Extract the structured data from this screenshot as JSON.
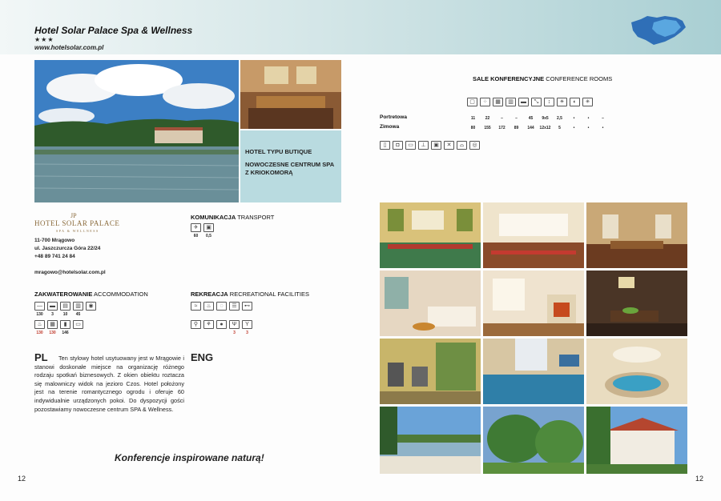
{
  "header": {
    "hotel_name": "Hotel Solar Palace Spa & Wellness",
    "stars": "★★★",
    "website": "www.hotelsolar.com.pl"
  },
  "info_box": {
    "line1": "HOTEL TYPU BUTIQUE",
    "line2": "NOWOCZESNE CENTRUM SPA Z KRIOKOMORĄ"
  },
  "logo": {
    "monogram": "JP",
    "text": "HOTEL SOLAR PALACE",
    "tagline": "SPA & WELLNESS"
  },
  "address": {
    "line1": "11-700 Mrągowo",
    "line2": "ul. Jaszczurcza Góra 22/24",
    "phone": "+48 89 741 24 84",
    "email": "mragowo@hotelsolar.com.pl"
  },
  "transport": {
    "title_pl": "KOMUNIKACJA",
    "title_en": "TRANSPORT",
    "values": [
      "60",
      "0,5"
    ]
  },
  "accommodation": {
    "title_pl": "ZAKWATEROWANIE",
    "title_en": "ACCOMMODATION",
    "row1_values": [
      "130",
      "3",
      "10",
      "45",
      ""
    ],
    "row2_values": [
      "130",
      "130",
      "146"
    ]
  },
  "recreation": {
    "title_pl": "REKREACJA",
    "title_en": "RECREATIONAL FACILITIES",
    "row2_values": [
      "",
      "",
      "",
      "3",
      "3"
    ]
  },
  "description": {
    "pl_label": "PL",
    "eng_label": "ENG",
    "text_pl": "Ten stylowy hotel usytuowany jest w Mrągowie i stanowi doskonałe miejsce na organizację różnego rodzaju spotkań biznesowych. Z okien obiektu roztacza się malowniczy widok na jezioro Czos. Hotel położony jest na terenie romantycznego ogrodu i oferuje 60 indywidualnie urządzonych pokoi. Do dyspozycji gości pozostawiamy nowoczesne centrum SPA & Wellness."
  },
  "slogan": "Konferencje inspirowane naturą!",
  "page_numbers": {
    "left": "12",
    "right": "12"
  },
  "conference": {
    "title_pl": "SALE KONFERENCYJNE",
    "title_en": "CONFERENCE ROOMS",
    "rows": [
      {
        "name": "Portretowa",
        "values": [
          "11",
          "22",
          "–",
          "–",
          "45",
          "9x5",
          "2,5",
          "•",
          "•",
          "–"
        ]
      },
      {
        "name": "Zimowa",
        "values": [
          "80",
          "155",
          "172",
          "89",
          "144",
          "12x12",
          "5",
          "•",
          "•",
          "•"
        ]
      }
    ]
  },
  "colors": {
    "header_band": "#c9e0e2",
    "info_box": "#b9dbe0",
    "logo_gold": "#8b6b3c",
    "highlight_red": "#c0392b",
    "map_blue": "#2f6fb7"
  }
}
